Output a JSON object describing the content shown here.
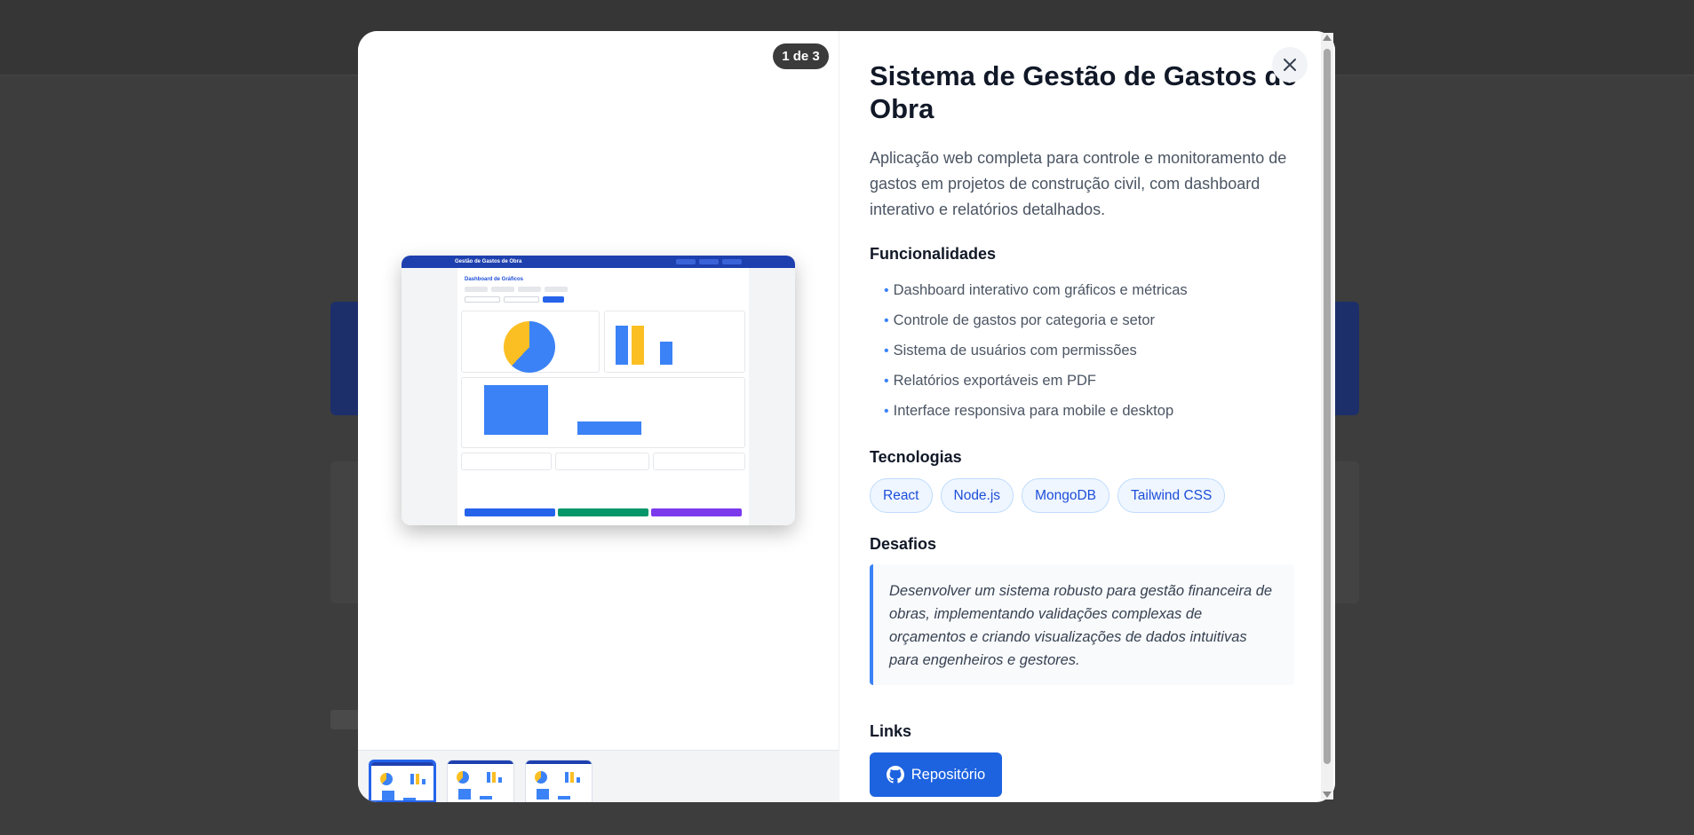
{
  "modal": {
    "counter": "1 de 3",
    "title": "Sistema de Gestão de Gastos de Obra",
    "description": "Aplicação web completa para controle e monitoramento de gastos em projetos de construção civil, com dashboard interativo e relatórios detalhados.",
    "features_heading": "Funcionalidades",
    "features": [
      "Dashboard interativo com gráficos e métricas",
      "Controle de gastos por categoria e setor",
      "Sistema de usuários com permissões",
      "Relatórios exportáveis em PDF",
      "Interface responsiva para mobile e desktop"
    ],
    "technologies_heading": "Tecnologias",
    "technologies": [
      "React",
      "Node.js",
      "MongoDB",
      "Tailwind CSS"
    ],
    "challenges_heading": "Desafios",
    "challenges_text": "Desenvolver um sistema robusto para gestão financeira de obras, implementando validações complexas de orçamentos e criando visualizações de dados intuitivas para engenheiros e gestores.",
    "links_heading": "Links",
    "repo_label": "Repositório"
  },
  "preview": {
    "app_title": "Gestão de Gastos de Obra",
    "dashboard_heading": "Dashboard de Gráficos"
  },
  "icons": {
    "close": "close-icon",
    "github": "github-icon"
  },
  "colors": {
    "accent": "#1d63e0",
    "chart_blue": "#3b82f6",
    "chart_yellow": "#fbbf24",
    "preview_header": "#1e40af"
  }
}
